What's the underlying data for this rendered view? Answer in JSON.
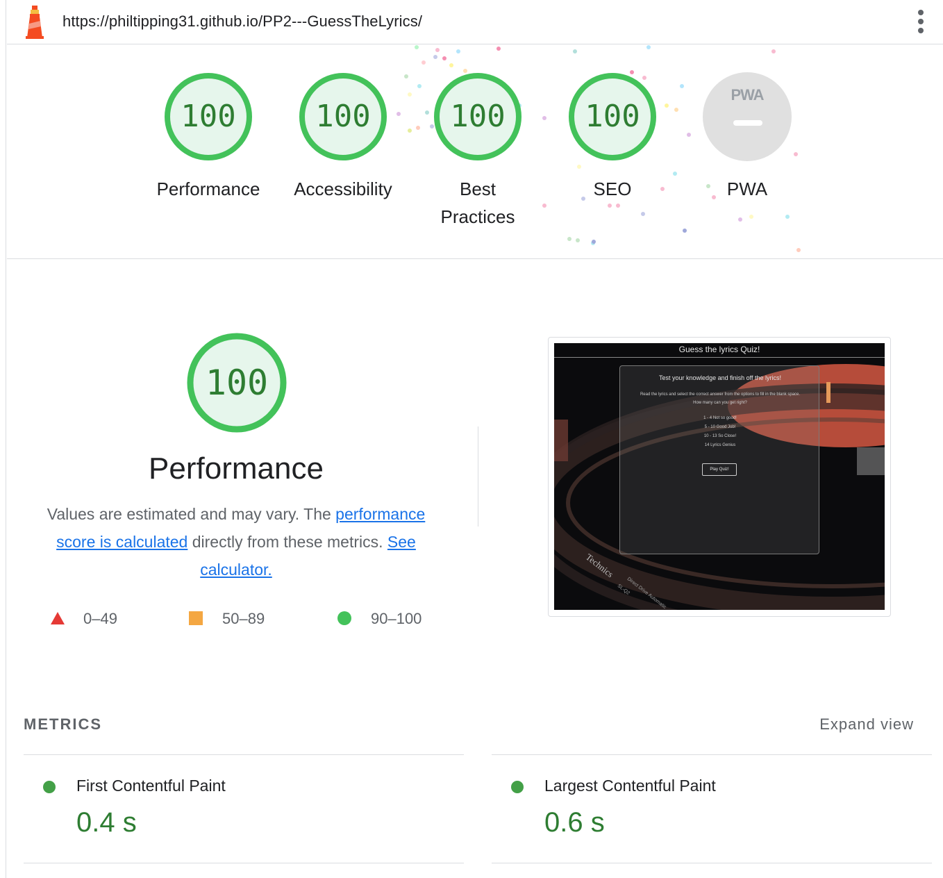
{
  "header": {
    "url": "https://philtipping31.github.io/PP2---GuessTheLyrics/"
  },
  "gauges": [
    {
      "score": "100",
      "label": "Performance"
    },
    {
      "score": "100",
      "label": "Accessibility"
    },
    {
      "score": "100",
      "label": "Best Practices"
    },
    {
      "score": "100",
      "label": "SEO"
    },
    {
      "badge": "PWA",
      "label": "PWA"
    }
  ],
  "performance": {
    "score": "100",
    "title": "Performance",
    "desc_prefix": "Values are estimated and may vary. The ",
    "desc_link1": "performance score is calculated",
    "desc_middle": " directly from these metrics. ",
    "desc_link2": "See calculator."
  },
  "legend": [
    {
      "range": "0–49",
      "color": "#e53935",
      "shape": "triangle"
    },
    {
      "range": "50–89",
      "color": "#f4a742",
      "shape": "square"
    },
    {
      "range": "90–100",
      "color": "#43a047",
      "shape": "circle"
    }
  ],
  "thumbnail": {
    "title": "Guess the lyrics Quiz!",
    "heading": "Test your knowledge and finish off the lyrics!",
    "line1": "Read the lyrics and select the correct answer from the options to fill in the blank space.",
    "line2": "How many can you get right?",
    "score1": "1 - 4 Not so good!",
    "score2": "5 - 10 Good Job!",
    "score3": "10 - 13 So Close!",
    "score4": "14 Lyrics Genius",
    "button": "Play Quiz!",
    "brand": "Technics",
    "brand_sub": "Direct Drive Automatic",
    "brand_model": "SL-Q2"
  },
  "metrics": {
    "heading": "METRICS",
    "expand_label": "Expand view",
    "items": [
      {
        "name": "First Contentful Paint",
        "value": "0.4 s",
        "status": "pass"
      },
      {
        "name": "Largest Contentful Paint",
        "value": "0.6 s",
        "status": "pass"
      }
    ]
  },
  "colors": {
    "pass": "#0cce6b",
    "pass_text": "#2e7d32",
    "link": "#1a73e8",
    "pwa_gray": "#e0e0e0"
  }
}
